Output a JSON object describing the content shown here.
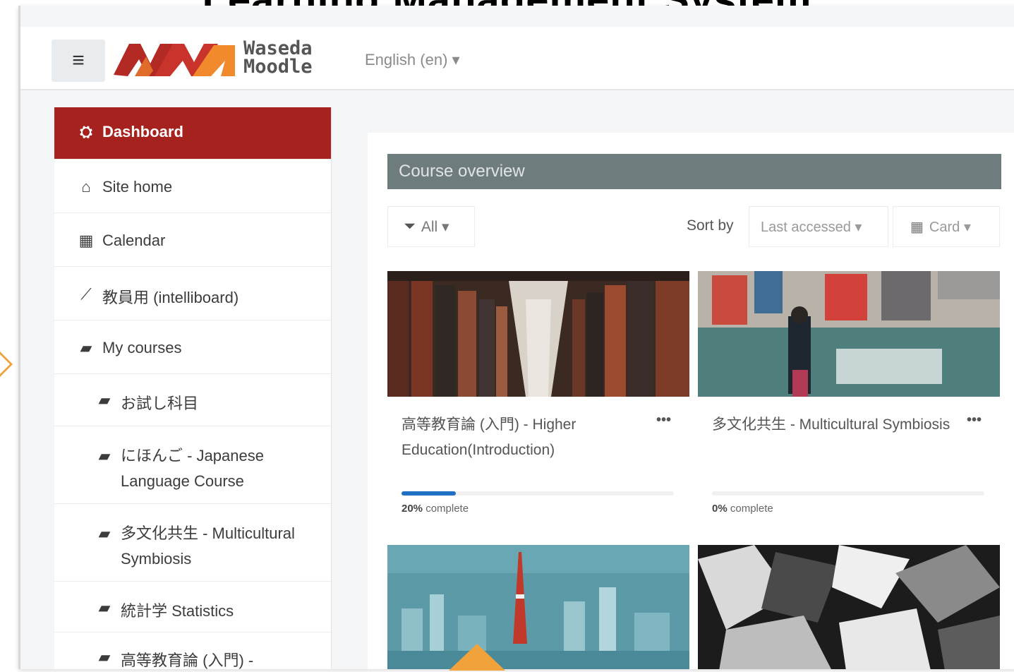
{
  "slide": {
    "title": "Learning Management System"
  },
  "header": {
    "logo_line1": "Waseda",
    "logo_line2": "Moodle",
    "language": "English (en) ▾",
    "hamburger_glyph": "≡"
  },
  "sidebar": {
    "items": [
      {
        "label": "Dashboard",
        "icon": "dashboard-icon",
        "glyph": "⛭",
        "active": true
      },
      {
        "label": "Site home",
        "icon": "home-icon",
        "glyph": "⌂"
      },
      {
        "label": "Calendar",
        "icon": "calendar-icon",
        "glyph": "▦"
      },
      {
        "label": "教員用 (intelliboard)",
        "icon": "line-chart-icon",
        "glyph": "⟋"
      },
      {
        "label": "My courses",
        "icon": "graduation-cap-icon",
        "glyph": "▰"
      },
      {
        "label": "お試し科目",
        "icon": "graduation-cap-icon",
        "glyph": "▰"
      },
      {
        "label": "にほんご - Japanese Language Course",
        "icon": "graduation-cap-icon",
        "glyph": "▰"
      },
      {
        "label": "多文化共生 - Multicultural Symbiosis",
        "icon": "graduation-cap-icon",
        "glyph": "▰"
      },
      {
        "label": "統計学 Statistics",
        "icon": "graduation-cap-icon",
        "glyph": "▰"
      },
      {
        "label": "高等教育論 (入門) -",
        "icon": "graduation-cap-icon",
        "glyph": "▰"
      }
    ]
  },
  "main": {
    "section_title": "Course overview",
    "filter_label": "All ▾",
    "filter_glyph": "⏷",
    "sort_label": "Sort by",
    "sort_value": "Last accessed ▾",
    "view_label": "Card ▾",
    "view_glyph": "▦",
    "courses": [
      {
        "title": "高等教育論 (入門) - Higher Education(Introduction)",
        "progress_pct": 20,
        "progress_value": "20%",
        "progress_suffix": " complete",
        "menu": "•••"
      },
      {
        "title": "多文化共生 - Multicultural Symbiosis",
        "progress_pct": 0,
        "progress_value": "0%",
        "progress_suffix": " complete",
        "menu": "•••"
      },
      {
        "title": "",
        "progress_pct": null
      },
      {
        "title": "",
        "progress_pct": null
      }
    ]
  },
  "colors": {
    "brand_red": "#a5221f",
    "section_header": "#6f7c7e",
    "progress_blue": "#1f6fc2",
    "callout_orange": "#f2a23a"
  }
}
